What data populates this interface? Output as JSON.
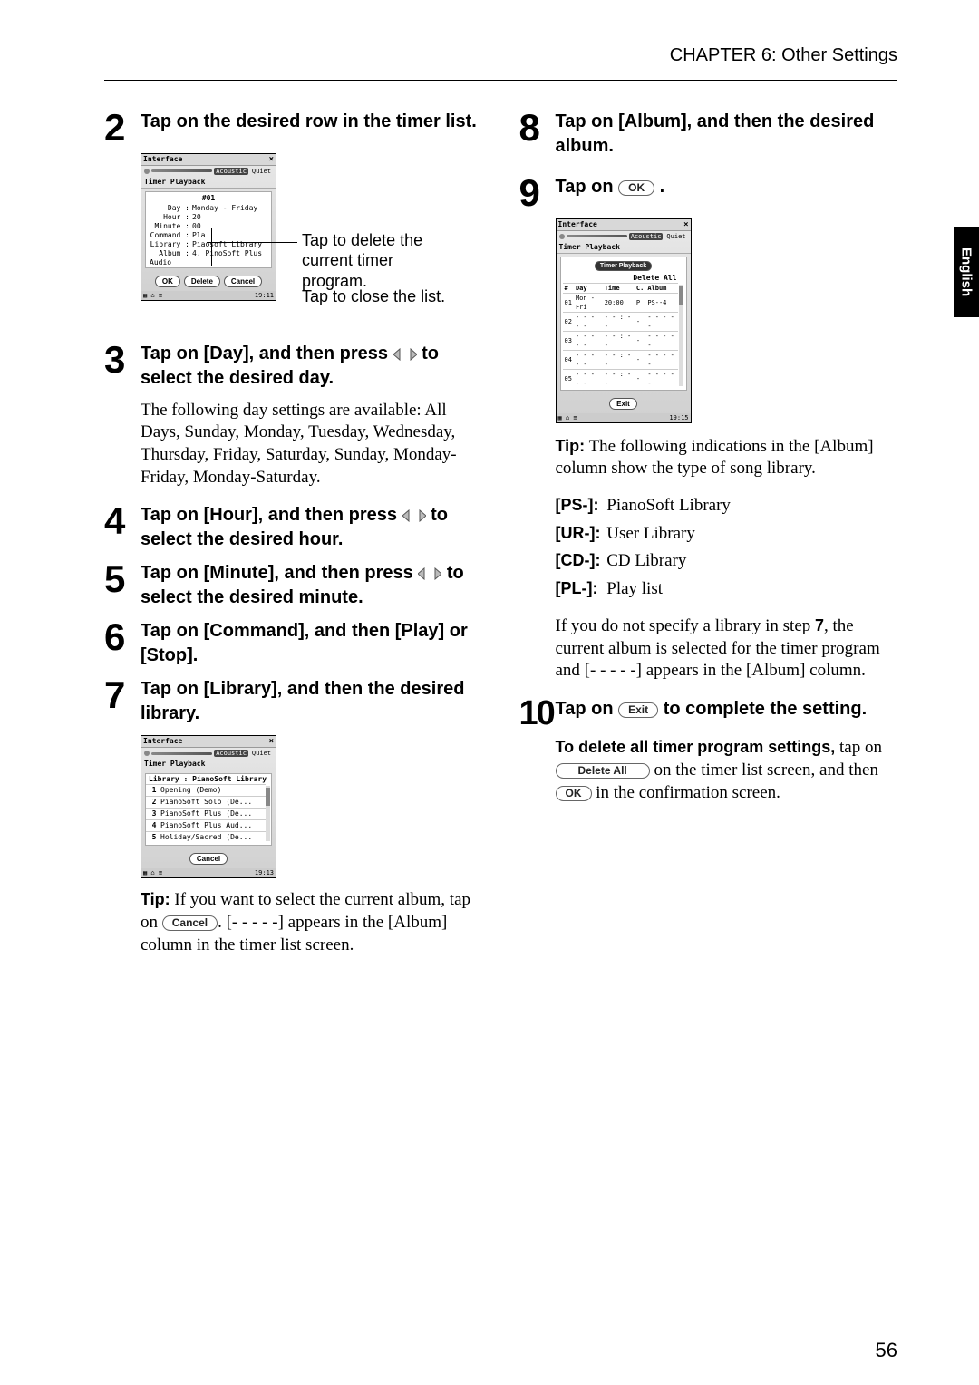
{
  "chapter": "CHAPTER 6: Other Settings",
  "language_tab": "English",
  "page_number": "56",
  "step2": {
    "num": "2",
    "text": "Tap on the desired row in the timer list.",
    "callout_delete": "Tap to delete the current timer program.",
    "callout_close": "Tap to close the list.",
    "device": {
      "title": "Interface",
      "acoustic": "Acoustic",
      "quiet": "Quiet",
      "sub": "Timer Playback",
      "panel_title": "#01",
      "rows": {
        "day_k": "Day :",
        "day_v": "Monday - Friday",
        "hour_k": "Hour :",
        "hour_v": "20",
        "min_k": "Minute :",
        "min_v": "00",
        "cmd_k": "Command :",
        "cmd_v": "Pla",
        "lib_k": "Library :",
        "lib_v": "Pia",
        "lib_v2": "osoft Library",
        "alb_k": "Album :",
        "alb_v": "4. P",
        "alb_v2": "inoSoft Plus Audio"
      },
      "btn_ok": "OK",
      "btn_delete": "Delete",
      "btn_cancel": "Cancel",
      "status_right": "19:11"
    }
  },
  "step3": {
    "num": "3",
    "text_pre": "Tap on [Day], and then press ",
    "text_post": " to select the desired day.",
    "body": "The following day settings are available: All Days, Sunday, Monday, Tuesday, Wednesday, Thursday, Friday, Saturday, Sunday, Monday-Friday, Monday-Saturday."
  },
  "step4": {
    "num": "4",
    "text_pre": "Tap on [Hour], and then press ",
    "text_post": " to select the desired hour."
  },
  "step5": {
    "num": "5",
    "text_pre": "Tap on [Minute], and then press ",
    "text_post": " to select the desired minute."
  },
  "step6": {
    "num": "6",
    "text": "Tap on [Command], and then [Play] or [Stop]."
  },
  "step7": {
    "num": "7",
    "text": "Tap on [Library], and then the desired library.",
    "device": {
      "title": "Interface",
      "acoustic": "Acoustic",
      "quiet": "Quiet",
      "sub": "Timer Playback",
      "header": "Library : PianoSoft Library",
      "items": [
        {
          "n": "1",
          "t": "Opening (Demo)"
        },
        {
          "n": "2",
          "t": "PianoSoft Solo (De..."
        },
        {
          "n": "3",
          "t": "PianoSoft Plus (De..."
        },
        {
          "n": "4",
          "t": "PianoSoft Plus Aud..."
        },
        {
          "n": "5",
          "t": "Holiday/Sacred (De..."
        }
      ],
      "btn_cancel": "Cancel",
      "status_right": "19:13"
    },
    "tip_label": "Tip:",
    "tip_text_a": " If you want to select the current album, tap on ",
    "tip_btn": "Cancel",
    "tip_text_b": ". [- - - - -] appears in the [Album] column in the timer list screen."
  },
  "step8": {
    "num": "8",
    "text": "Tap on [Album], and then the desired album."
  },
  "step9": {
    "num": "9",
    "text_pre": "Tap on ",
    "ok_btn": "OK",
    "text_post": " .",
    "device": {
      "title": "Interface",
      "acoustic": "Acoustic",
      "quiet": "Quiet",
      "sub": "Timer Playback",
      "title_pill": "Timer Playback",
      "delete_all": "Delete All",
      "head": {
        "n": "#",
        "day": "Day",
        "time": "Time",
        "c": "C.",
        "album": "Album"
      },
      "rows": [
        {
          "n": "01",
          "day": "Mon - Fri",
          "time": "20:00",
          "c": "P",
          "album": "PS--4"
        },
        {
          "n": "02",
          "day": "- - - - -",
          "time": "- - : - -",
          "c": "-",
          "album": "- - - - -"
        },
        {
          "n": "03",
          "day": "- - - - -",
          "time": "- - : - -",
          "c": "-",
          "album": "- - - - -"
        },
        {
          "n": "04",
          "day": "- - - - -",
          "time": "- - : - -",
          "c": "-",
          "album": "- - - - -"
        },
        {
          "n": "05",
          "day": "- - - - -",
          "time": "- - : - -",
          "c": "-",
          "album": "- - - - -"
        }
      ],
      "btn_exit": "Exit",
      "status_right": "19:15"
    },
    "tip_label": "Tip:",
    "tip_text": " The following indications in the [Album] column show the type of song library.",
    "prefixes": [
      {
        "k": "[PS-]:",
        "v": "PianoSoft Library"
      },
      {
        "k": "[UR-]:",
        "v": "User Library"
      },
      {
        "k": "[CD-]:",
        "v": "CD Library"
      },
      {
        "k": "[PL-]:",
        "v": "Play list"
      }
    ],
    "body2_a": "If you do not specify a library in step ",
    "body2_bold": "7",
    "body2_b": ", the current album is selected for the timer program and [- - - - -] appears in the [Album] column."
  },
  "step10": {
    "num": "10",
    "text_pre": "Tap on ",
    "exit_btn": "Exit",
    "text_post": " to complete the setting.",
    "delete_heading": "To delete all timer program settings,",
    "delete_a": " tap on ",
    "delete_btn1": "Delete All",
    "delete_b": " on the timer list screen, and then ",
    "delete_btn2": "OK",
    "delete_c": " in the confirmation screen."
  }
}
